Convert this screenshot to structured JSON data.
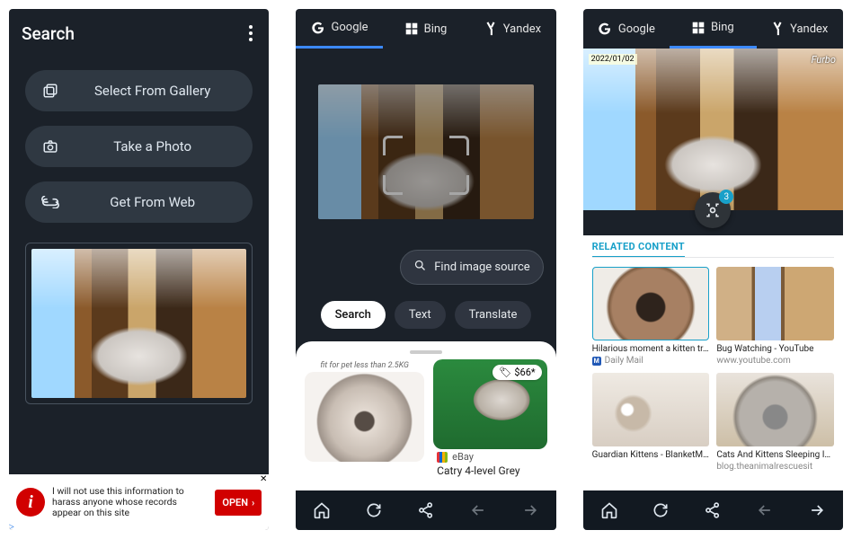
{
  "screen1": {
    "title": "Search",
    "buttons": {
      "gallery": "Select From Gallery",
      "photo": "Take a Photo",
      "web": "Get From Web"
    },
    "ad": {
      "text": "I will not use this information to harass anyone whose records appear on this site",
      "cta": "OPEN"
    }
  },
  "tabs": {
    "google": "Google",
    "bing": "Bing",
    "yandex": "Yandex"
  },
  "screen2": {
    "find_source": "Find image source",
    "chips": {
      "search": "Search",
      "text": "Text",
      "translate": "Translate"
    },
    "result1_caption": "fit for pet less than 2.5KG",
    "result2": {
      "price": "$66*",
      "store": "eBay",
      "title": "Catry 4-level Grey"
    }
  },
  "screen3": {
    "watermark_date": "2022/01/02",
    "watermark_brand": "Furbo",
    "crop_badge": "3",
    "related_heading": "RELATED CONTENT",
    "cards": [
      {
        "title": "Hilarious moment a kitten tr…",
        "source": "Daily Mail"
      },
      {
        "title": "Bug Watching - YouTube",
        "source": "www.youtube.com"
      },
      {
        "title": "Guardian Kittens - BlanketM…",
        "source": ""
      },
      {
        "title": "Cats And Kittens Sleeping I…",
        "source": "blog.theanimalrescuesit"
      }
    ]
  }
}
